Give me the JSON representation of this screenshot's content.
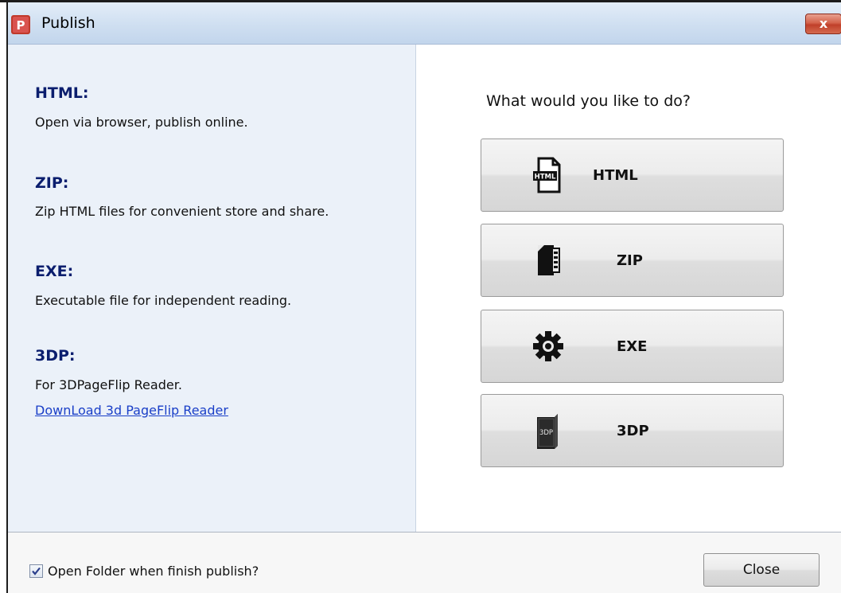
{
  "window": {
    "title": "Publish",
    "close_glyph": "x"
  },
  "left": {
    "items": [
      {
        "title": "HTML:",
        "desc": "Open via browser, publish online."
      },
      {
        "title": "ZIP:",
        "desc": "Zip HTML files for convenient store and share."
      },
      {
        "title": "EXE:",
        "desc": "Executable file for independent reading."
      },
      {
        "title": "3DP:",
        "desc": "For 3DPageFlip Reader.",
        "link": "DownLoad 3d PageFlip Reader"
      }
    ]
  },
  "right": {
    "prompt": "What would you like to do?",
    "buttons": [
      {
        "label": "HTML",
        "icon": "html-file-icon",
        "icon_text": "HTML"
      },
      {
        "label": "ZIP",
        "icon": "zip-file-icon"
      },
      {
        "label": "EXE",
        "icon": "gear-icon"
      },
      {
        "label": "3DP",
        "icon": "3dp-file-icon",
        "icon_text": "3DP"
      }
    ]
  },
  "footer": {
    "checkbox_label": "Open Folder when finish publish?",
    "checkbox_checked": true,
    "close_label": "Close"
  },
  "colors": {
    "title_bar": "#cfdff1",
    "left_panel": "#ebf1f9",
    "heading_text": "#0b1e6e",
    "link": "#1a3fc8",
    "close_red": "#c0402a"
  }
}
